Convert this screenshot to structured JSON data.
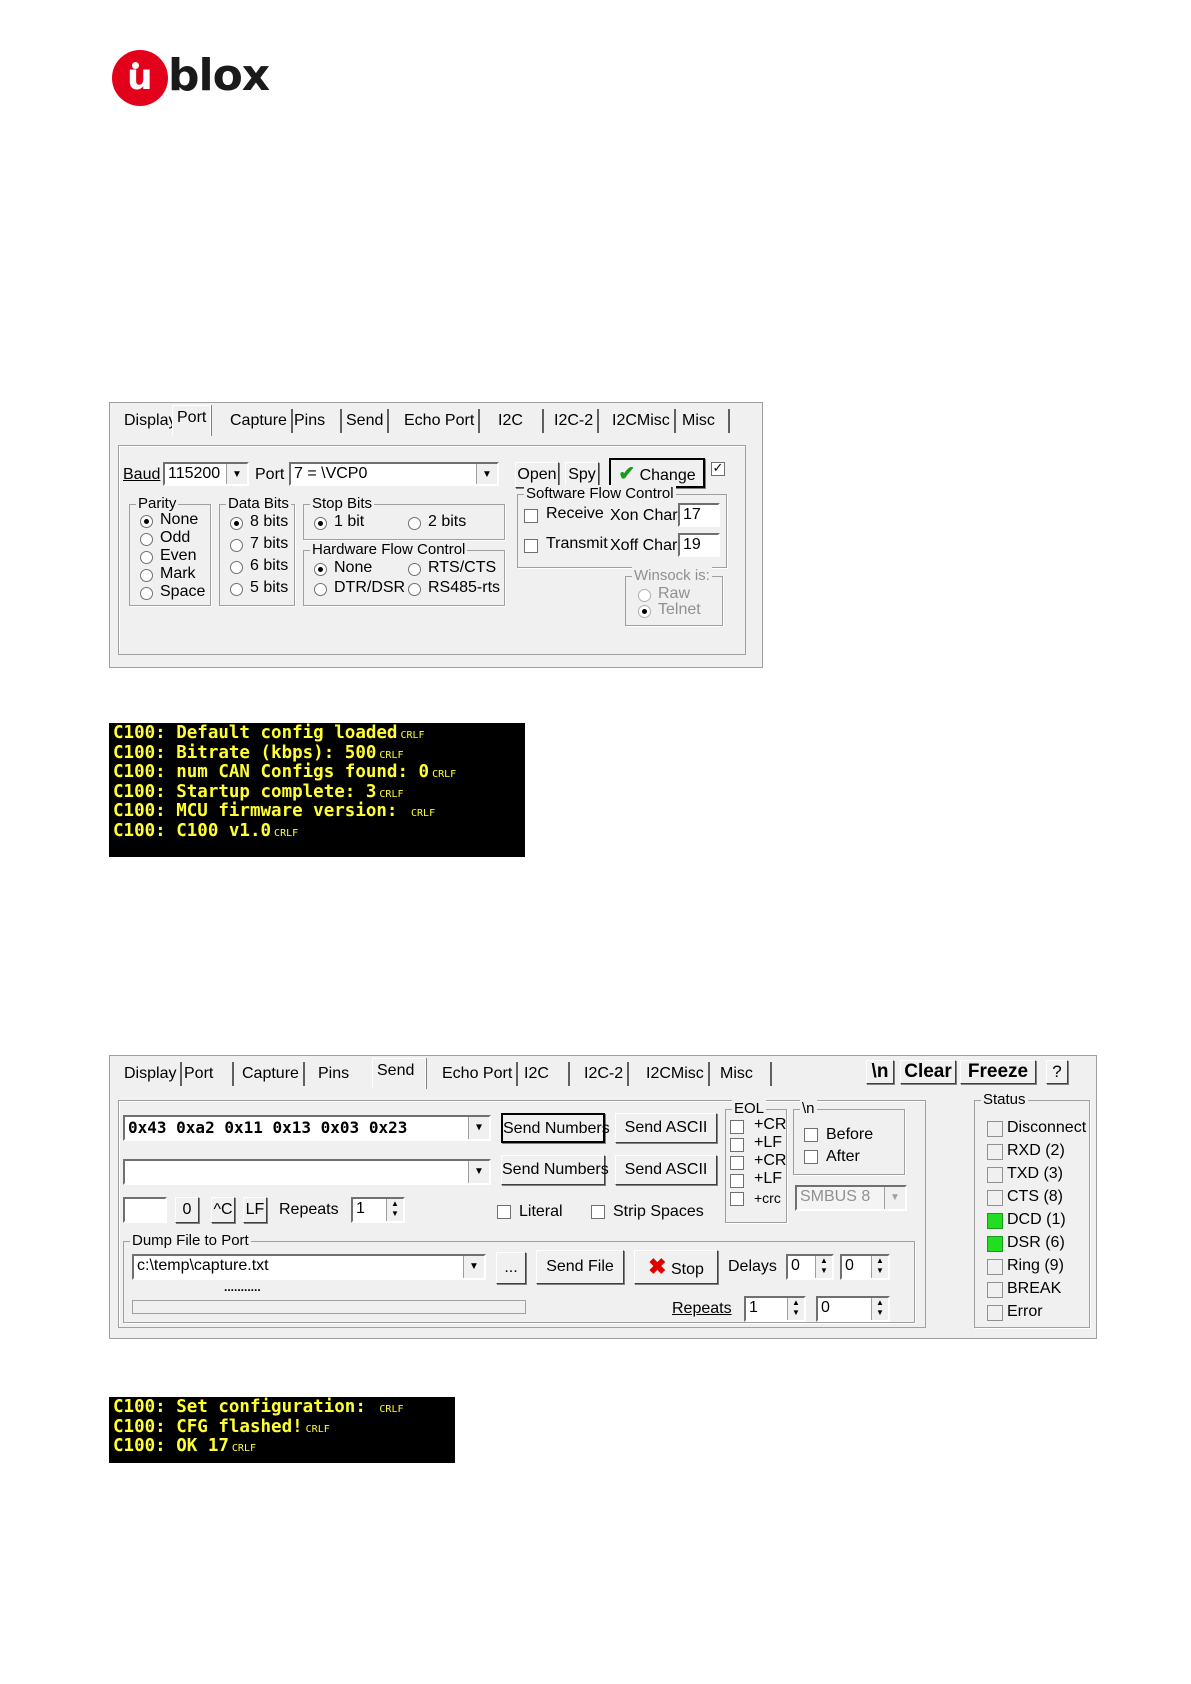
{
  "logo": {
    "text": "ublox"
  },
  "port_dialog": {
    "tabs": [
      "Display",
      "Port",
      "Capture",
      "Pins",
      "Send",
      "Echo Port",
      "I2C",
      "I2C-2",
      "I2CMisc",
      "Misc"
    ],
    "active_tab": "Port",
    "baud_label": "Baud",
    "baud_value": "115200",
    "port_label": "Port",
    "port_value": "7 = \\VCP0",
    "open_button": "Open",
    "spy_button": "Spy",
    "change_button": "Change",
    "parity": {
      "title": "Parity",
      "options": [
        "None",
        "Odd",
        "Even",
        "Mark",
        "Space"
      ],
      "selected": "None"
    },
    "data_bits": {
      "title": "Data Bits",
      "options": [
        "8 bits",
        "7 bits",
        "6 bits",
        "5 bits"
      ],
      "selected": "8 bits"
    },
    "stop_bits": {
      "title": "Stop Bits",
      "options": [
        "1 bit",
        "2 bits"
      ],
      "selected": "1 bit"
    },
    "hw_flow": {
      "title": "Hardware Flow Control",
      "options": [
        "None",
        "RTS/CTS",
        "DTR/DSR",
        "RS485-rts"
      ],
      "selected": "None"
    },
    "sw_flow": {
      "title": "Software Flow Control",
      "receive_label": "Receive",
      "transmit_label": "Transmit",
      "xon_label": "Xon Char:",
      "xon_value": "17",
      "xoff_label": "Xoff Char:",
      "xoff_value": "19"
    },
    "winsock": {
      "title": "Winsock is:",
      "options": [
        "Raw",
        "Telnet"
      ],
      "selected": "Telnet"
    }
  },
  "terminal1": {
    "crlf": "CRLF",
    "lines": [
      "C100: Default config loaded",
      "C100: Bitrate (kbps): 500",
      "C100: num CAN Configs found: 0",
      "C100: Startup complete: 3",
      "C100: MCU firmware version: ",
      "C100: C100 v1.0"
    ]
  },
  "send_dialog": {
    "tabs": [
      "Display",
      "Port",
      "Capture",
      "Pins",
      "Send",
      "Echo Port",
      "I2C",
      "I2C-2",
      "I2CMisc",
      "Misc"
    ],
    "active_tab": "Send",
    "toolbar": {
      "newline": "\\n",
      "clear": "Clear",
      "freeze": "Freeze",
      "help": "?"
    },
    "numbers_value": "0x43 0xa2 0x11 0x13 0x03 0x23",
    "send_numbers": "Send Numbers",
    "send_ascii": "Send ASCII",
    "zero_button": "0",
    "ctrl_c_button": "^C",
    "lf_button": "LF",
    "repeats_label": "Repeats",
    "repeats_value": "1",
    "literal_label": "Literal",
    "strip_spaces_label": "Strip Spaces",
    "eol": {
      "title": "EOL",
      "options": [
        "+CR",
        "+LF",
        "+CR",
        "+LF",
        "+crc"
      ]
    },
    "newline_group": {
      "title": "\\n",
      "before": "Before",
      "after": "After"
    },
    "smbus_value": "SMBUS 8",
    "dump": {
      "title": "Dump File to Port",
      "path": "c:\\temp\\capture.txt",
      "browse": "...",
      "send_file": "Send File",
      "stop": "Stop",
      "delays_label": "Delays",
      "delay1": "0",
      "delay2": "0",
      "progress_text": "...........",
      "repeats_label": "Repeats",
      "repeats1": "1",
      "repeats2": "0"
    },
    "status": {
      "title": "Status",
      "items": [
        {
          "label": "Disconnect",
          "on": false
        },
        {
          "label": "RXD (2)",
          "on": false
        },
        {
          "label": "TXD (3)",
          "on": false
        },
        {
          "label": "CTS (8)",
          "on": false
        },
        {
          "label": "DCD (1)",
          "on": true
        },
        {
          "label": "DSR (6)",
          "on": true
        },
        {
          "label": "Ring (9)",
          "on": false
        },
        {
          "label": "BREAK",
          "on": false
        },
        {
          "label": "Error",
          "on": false
        }
      ]
    }
  },
  "terminal2": {
    "crlf": "CRLF",
    "lines": [
      "C100: Set configuration: ",
      "C100: CFG flashed!",
      "C100: OK 17"
    ]
  },
  "colors": {
    "logo_red": "#e3001b",
    "terminal_text": "#ffff33",
    "led_on": "#22dd22"
  }
}
